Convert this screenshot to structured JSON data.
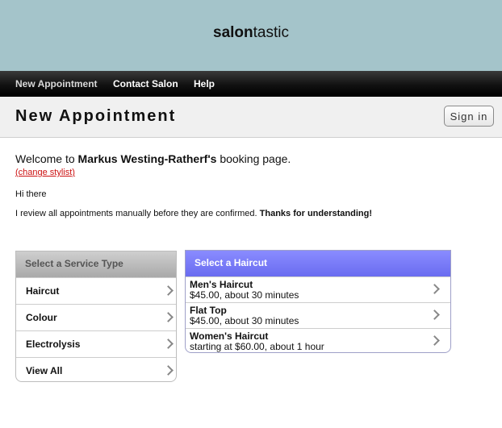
{
  "brand": {
    "bold": "salon",
    "rest": "tastic"
  },
  "nav": [
    {
      "label": "New Appointment"
    },
    {
      "label": "Contact Salon"
    },
    {
      "label": "Help"
    }
  ],
  "page": {
    "title": "New Appointment",
    "signin_label": "Sign in"
  },
  "welcome": {
    "prefix": "Welcome to ",
    "stylist": "Markus Westing-Ratherf's",
    "suffix": " booking page.",
    "change_link": "(change stylist)",
    "greeting": "Hi there",
    "review_text": "I review all appointments manually before they are confirmed. ",
    "review_bold": "Thanks for understanding!"
  },
  "service_panel": {
    "title": "Select a Service Type",
    "items": [
      {
        "label": "Haircut"
      },
      {
        "label": "Colour"
      },
      {
        "label": "Electrolysis"
      },
      {
        "label": "View All"
      }
    ]
  },
  "haircut_panel": {
    "title": "Select a Haircut",
    "items": [
      {
        "name": "Men's Haircut",
        "detail": "$45.00, about 30 minutes"
      },
      {
        "name": "Flat Top",
        "detail": "$45.00, about 30 minutes"
      },
      {
        "name": "Women's Haircut",
        "detail": "starting at $60.00, about 1 hour"
      }
    ]
  },
  "colors": {
    "banner": "#a4c4ca",
    "accent": "#7173f8",
    "link": "#cc1111"
  }
}
